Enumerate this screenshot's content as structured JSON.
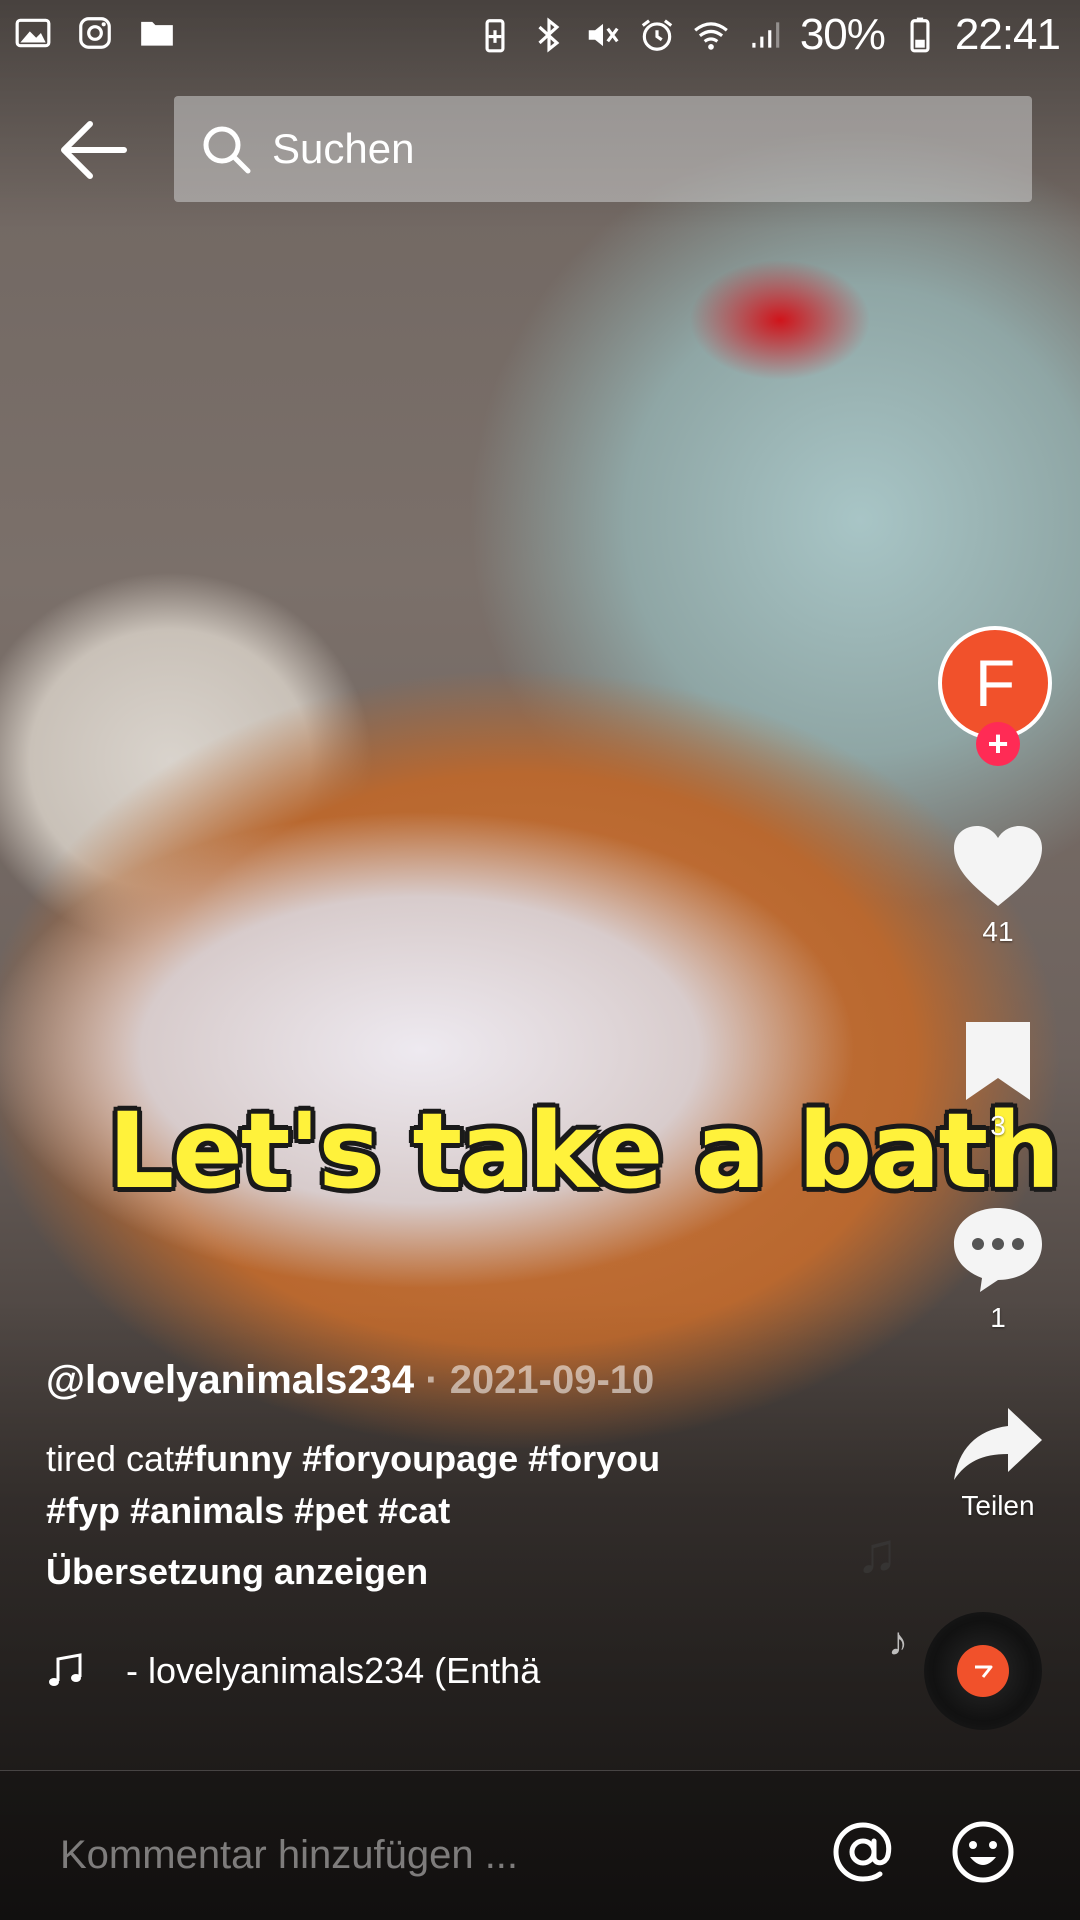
{
  "status_bar": {
    "battery_percent": "30%",
    "time": "22:41",
    "left_icons": [
      "gallery-icon",
      "instagram-icon",
      "folder-icon"
    ],
    "right_icons": [
      "battery-saver-icon",
      "bluetooth-icon",
      "mute-icon",
      "alarm-icon",
      "wifi-icon",
      "signal-icon",
      "battery-icon"
    ]
  },
  "search": {
    "placeholder": "Suchen"
  },
  "video": {
    "caption_overlay": "Let's take a bath"
  },
  "post": {
    "username": "@lovelyanimals234",
    "separator": "·",
    "date": "2021-09-10",
    "description_text": "tired cat",
    "description_tags_line1": "#funny #foryoupage #foryou",
    "description_tags_line2": "#fyp #animals #pet #cat",
    "translate_label": "Übersetzung anzeigen",
    "music": "- lovelyanimals234 (Enthä"
  },
  "rail": {
    "avatar_letter": "F",
    "follow_symbol": "+",
    "likes": "41",
    "saves": "3",
    "comments": "1",
    "share_label": "Teilen"
  },
  "comment_bar": {
    "placeholder": "Kommentar hinzufügen ..."
  },
  "colors": {
    "accent_orange": "#f1512b",
    "follow_pink": "#ff2b55",
    "caption_yellow": "#fff23b"
  }
}
